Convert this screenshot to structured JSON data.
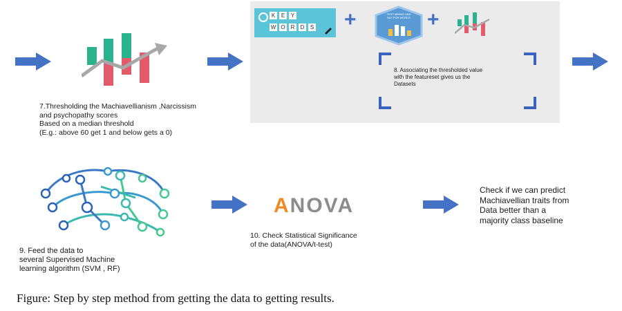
{
  "step7": {
    "text": "7.Thresholding the Machiavellianism ,Narcissism\nand psychopathy scores\nBased on a median threshold\n(E.g.: above 60 get 1 and below gets a 0)"
  },
  "step8": {
    "text": "8. Associating the thresholded value\nwith the featureset gives us the\nDatasets",
    "keywords_image_text": [
      "K",
      "E",
      "Y",
      "W",
      "O",
      "R",
      "D",
      "S"
    ],
    "badge_image_text": "TEXT MINING AND\nNLP FOR WORDS"
  },
  "step9": {
    "text": "9. Feed the data to\nseveral Supervised Machine\nlearning algorithm (SVM , RF)"
  },
  "step10": {
    "logo_first": "A",
    "logo_rest": "NOVA",
    "text": "10. Check Statistical Significance\nof the data(ANOVA/t-test)"
  },
  "final": {
    "text": "Check if we can predict\nMachiavellian traits from\nData better than a\nmajority class baseline"
  },
  "operators": {
    "plus": "+"
  },
  "caption": "Figure: Step by step method from getting the data to getting results.",
  "colors": {
    "arrow": "#4472c4",
    "bar_green": "#2ab28c",
    "bar_red": "#e35a6a",
    "trend_gray": "#a8a8a8",
    "panel_bg": "#ebebeb",
    "corner_blue": "#3a62c0",
    "anova_orange": "#f08a24",
    "anova_gray": "#8c8c8c"
  }
}
